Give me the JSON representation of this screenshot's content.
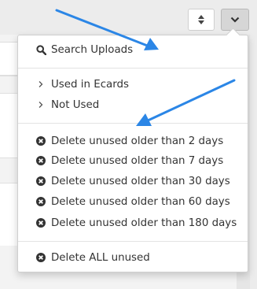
{
  "toolbar": {
    "sort_icon": "sort-updown-icon",
    "menu_icon": "chevron-down-icon"
  },
  "menu": {
    "search": {
      "label": "Search Uploads",
      "icon": "search-icon"
    },
    "filters": [
      {
        "label": "Used in Ecards",
        "icon": "chevron-right-icon"
      },
      {
        "label": "Not Used",
        "icon": "chevron-right-icon"
      }
    ],
    "delete_options": [
      {
        "label": "Delete unused older than 2 days",
        "icon": "remove-circle-icon"
      },
      {
        "label": "Delete unused older than 7 days",
        "icon": "remove-circle-icon"
      },
      {
        "label": "Delete unused older than 30 days",
        "icon": "remove-circle-icon"
      },
      {
        "label": "Delete unused older than 60 days",
        "icon": "remove-circle-icon"
      },
      {
        "label": "Delete unused older than 180 days",
        "icon": "remove-circle-icon"
      }
    ],
    "delete_all": {
      "label": "Delete ALL unused",
      "icon": "remove-circle-icon"
    }
  },
  "colors": {
    "annotation_arrow": "#2b86e6"
  }
}
